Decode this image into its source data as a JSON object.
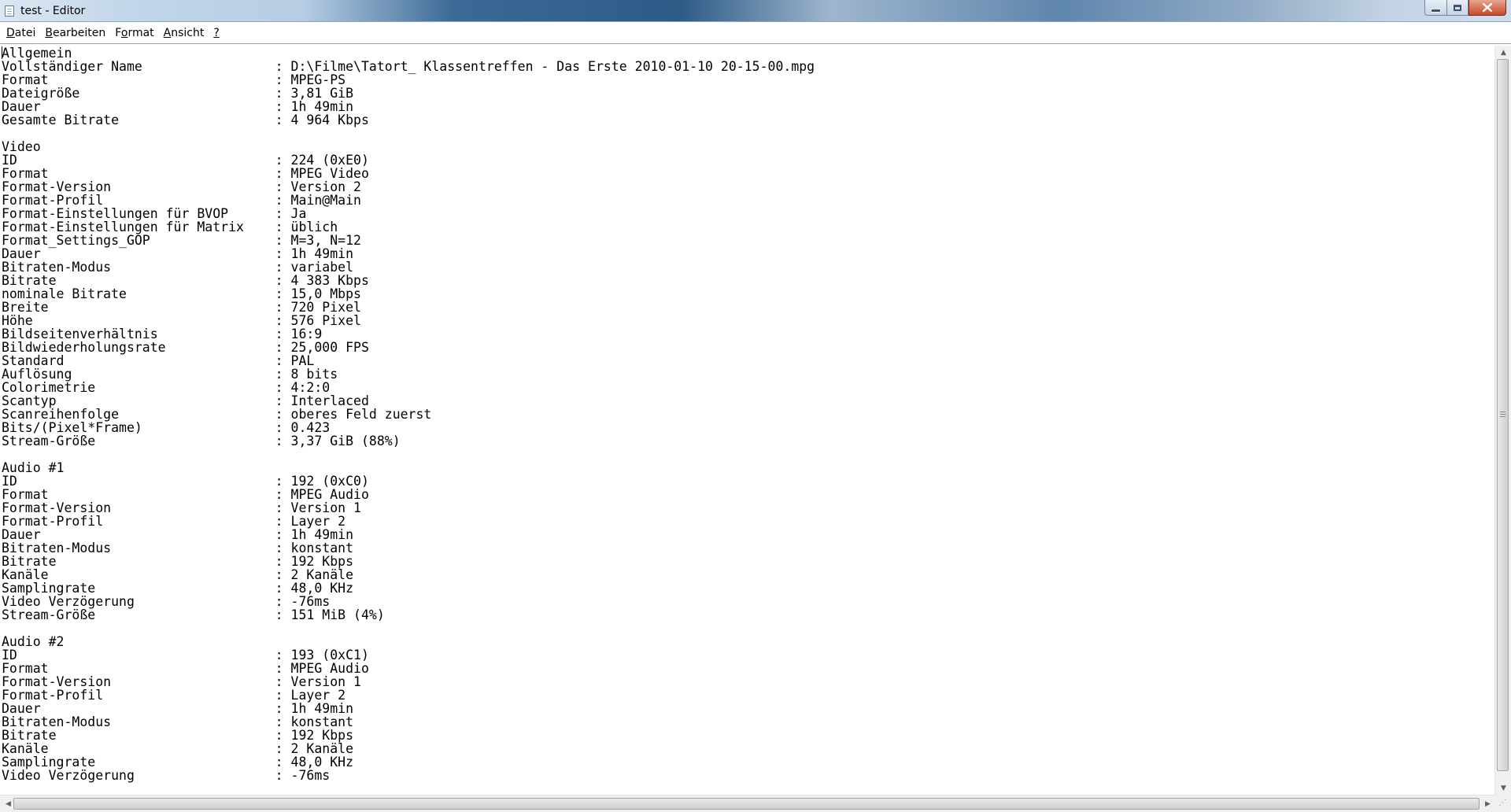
{
  "window": {
    "title": "test - Editor",
    "icon": "notepad-icon",
    "buttons": {
      "minimize_icon": "minimize-icon",
      "maximize_icon": "maximize-icon",
      "close_icon": "close-icon"
    }
  },
  "menu": {
    "items": [
      {
        "label_acc": "D",
        "label_rest": "atei"
      },
      {
        "label_acc": "B",
        "label_rest": "earbeiten"
      },
      {
        "label_pre": "F",
        "label_acc": "o",
        "label_rest": "rmat"
      },
      {
        "label_acc": "A",
        "label_rest": "nsicht"
      },
      {
        "label_acc": "?",
        "label_rest": ""
      }
    ]
  },
  "document": {
    "content": "Allgemein\nVollständiger Name                 : D:\\Filme\\Tatort_ Klassentreffen - Das Erste 2010-01-10 20-15-00.mpg\nFormat                             : MPEG-PS\nDateigröße                         : 3,81 GiB\nDauer                              : 1h 49min\nGesamte Bitrate                    : 4 964 Kbps\n\nVideo\nID                                 : 224 (0xE0)\nFormat                             : MPEG Video\nFormat-Version                     : Version 2\nFormat-Profil                      : Main@Main\nFormat-Einstellungen für BVOP      : Ja\nFormat-Einstellungen für Matrix    : üblich\nFormat_Settings_GOP                : M=3, N=12\nDauer                              : 1h 49min\nBitraten-Modus                     : variabel\nBitrate                            : 4 383 Kbps\nnominale Bitrate                   : 15,0 Mbps\nBreite                             : 720 Pixel\nHöhe                               : 576 Pixel\nBildseitenverhältnis               : 16:9\nBildwiederholungsrate              : 25,000 FPS\nStandard                           : PAL\nAuflösung                          : 8 bits\nColorimetrie                       : 4:2:0\nScantyp                            : Interlaced\nScanreihenfolge                    : oberes Feld zuerst\nBits/(Pixel*Frame)                 : 0.423\nStream-Größe                       : 3,37 GiB (88%)\n\nAudio #1\nID                                 : 192 (0xC0)\nFormat                             : MPEG Audio\nFormat-Version                     : Version 1\nFormat-Profil                      : Layer 2\nDauer                              : 1h 49min\nBitraten-Modus                     : konstant\nBitrate                            : 192 Kbps\nKanäle                             : 2 Kanäle\nSamplingrate                       : 48,0 KHz\nVideo Verzögerung                  : -76ms\nStream-Größe                       : 151 MiB (4%)\n\nAudio #2\nID                                 : 193 (0xC1)\nFormat                             : MPEG Audio\nFormat-Version                     : Version 1\nFormat-Profil                      : Layer 2\nDauer                              : 1h 49min\nBitraten-Modus                     : konstant\nBitrate                            : 192 Kbps\nKanäle                             : 2 Kanäle\nSamplingrate                       : 48,0 KHz\nVideo Verzögerung                  : -76ms"
  },
  "scrollbars": {
    "up_arrow": "▲",
    "down_arrow": "▼",
    "left_arrow": "◀",
    "right_arrow": "▶"
  }
}
